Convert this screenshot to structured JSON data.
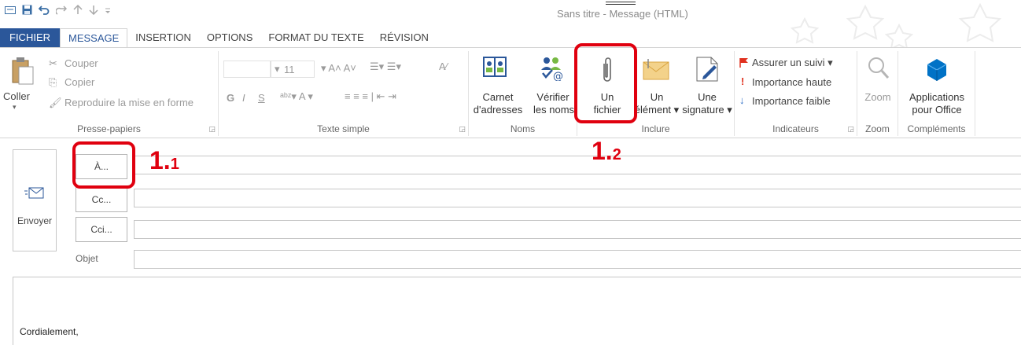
{
  "window": {
    "title": "Sans titre - Message (HTML)"
  },
  "quick_access": [
    "mail-icon",
    "save-icon",
    "undo-icon",
    "redo-icon",
    "up-icon",
    "down-icon",
    "customize-icon"
  ],
  "tabs": [
    {
      "label": "FICHIER"
    },
    {
      "label": "MESSAGE"
    },
    {
      "label": "INSERTION"
    },
    {
      "label": "OPTIONS"
    },
    {
      "label": "FORMAT DU TEXTE"
    },
    {
      "label": "RÉVISION"
    }
  ],
  "ribbon": {
    "clipboard": {
      "paste": "Coller",
      "cut": "Couper",
      "copy": "Copier",
      "format_painter": "Reproduire la mise en forme",
      "label": "Presse-papiers"
    },
    "basic_text": {
      "font_size": "11",
      "bold": "G",
      "italic": "I",
      "underline": "S",
      "label": "Texte simple"
    },
    "names": {
      "address_book_line1": "Carnet",
      "address_book_line2": "d'adresses",
      "check_names_line1": "Vérifier",
      "check_names_line2": "les noms",
      "label": "Noms"
    },
    "include": {
      "attach_file_line1": "Un",
      "attach_file_line2": "fichier",
      "attach_item_line1": "Un",
      "attach_item_line2": "élément ▾",
      "signature_line1": "Une",
      "signature_line2": "signature ▾",
      "label": "Inclure"
    },
    "tags": {
      "follow_up": "Assurer un suivi ▾",
      "high_importance": "Importance haute",
      "low_importance": "Importance faible",
      "label": "Indicateurs"
    },
    "zoom": {
      "button": "Zoom",
      "label": "Zoom"
    },
    "addins": {
      "line1": "Applications",
      "line2": "pour Office",
      "label": "Compléments"
    }
  },
  "compose": {
    "send": "Envoyer",
    "to_button": "À...",
    "cc_button": "Cc...",
    "bcc_button": "Cci...",
    "subject_label": "Objet",
    "to_value": "",
    "cc_value": "",
    "bcc_value": "",
    "subject_value": "",
    "body_signature": "Cordialement,"
  },
  "annotations": {
    "step1_main": "1.",
    "step1_sub": "1",
    "step2_main": "1.",
    "step2_sub": "2"
  },
  "colors": {
    "accent": "#2b579a",
    "annotation_red": "#e0000f",
    "flag_red": "#e0301e",
    "importance_blue": "#2b6cc4"
  }
}
